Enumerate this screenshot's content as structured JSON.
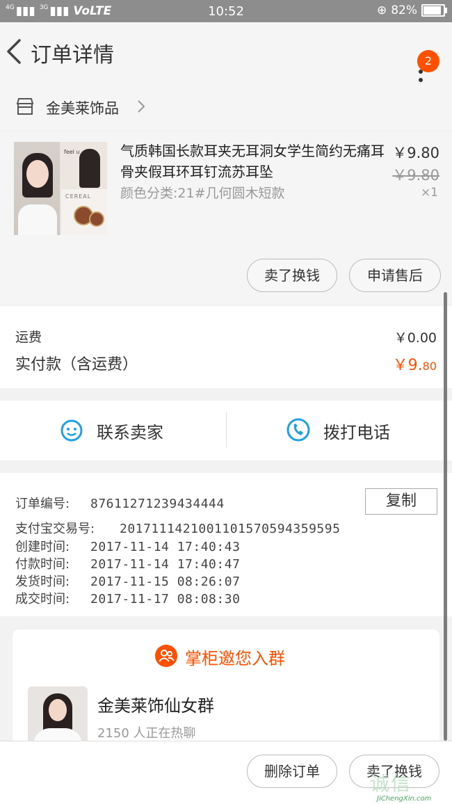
{
  "status_bar": {
    "signal1": "4G",
    "signal2": "3G",
    "network": "VoLTE",
    "time": "10:52",
    "battery": "82%",
    "battery_level": 0.82
  },
  "header": {
    "title": "订单详情",
    "badge_count": "2"
  },
  "shop": {
    "name": "金美莱饰品"
  },
  "product": {
    "name": "气质韩国长款耳夹无耳洞女学生简约无痛耳骨夹假耳环耳钉流苏耳坠",
    "sku": "颜色分类:21#几何圆木短款",
    "price": "￥9.80",
    "original_price": "￥9.80",
    "quantity": "×1",
    "thumb_text1": "feel u",
    "thumb_text2": "CEREAL",
    "buttons": {
      "resell": "卖了换钱",
      "after_sale": "申请售后"
    }
  },
  "fees": {
    "shipping_label": "运费",
    "shipping_value": "￥0.00",
    "paid_label": "实付款（含运费）",
    "paid_main": "￥9.",
    "paid_cents": "80"
  },
  "contact": {
    "seller": "联系卖家",
    "call": "拨打电话"
  },
  "order_info": {
    "copy_button": "复制",
    "rows": [
      {
        "label": "订单编号:",
        "value": "87611271239434444"
      },
      {
        "label": "支付宝交易号:",
        "value": "2017111421001101570594359595"
      },
      {
        "label": "创建时间:",
        "value": "2017-11-14 17:40:43"
      },
      {
        "label": "付款时间:",
        "value": "2017-11-14 17:40:47"
      },
      {
        "label": "发货时间:",
        "value": "2017-11-15 08:26:07"
      },
      {
        "label": "成交时间:",
        "value": "2017-11-17 08:08:30"
      }
    ]
  },
  "group_card": {
    "title": "掌柜邀您入群",
    "group_name": "金美莱饰仙女群",
    "member_text": "2150 人正在热聊"
  },
  "bottom_bar": {
    "delete_order": "删除订单",
    "resell": "卖了换钱"
  },
  "watermark": {
    "big": "诚信",
    "small": "JiChengXin.com"
  },
  "colors": {
    "accent": "#ff5000",
    "icon_blue": "#1fa0e3",
    "status_bar": "#8d8d8d"
  }
}
